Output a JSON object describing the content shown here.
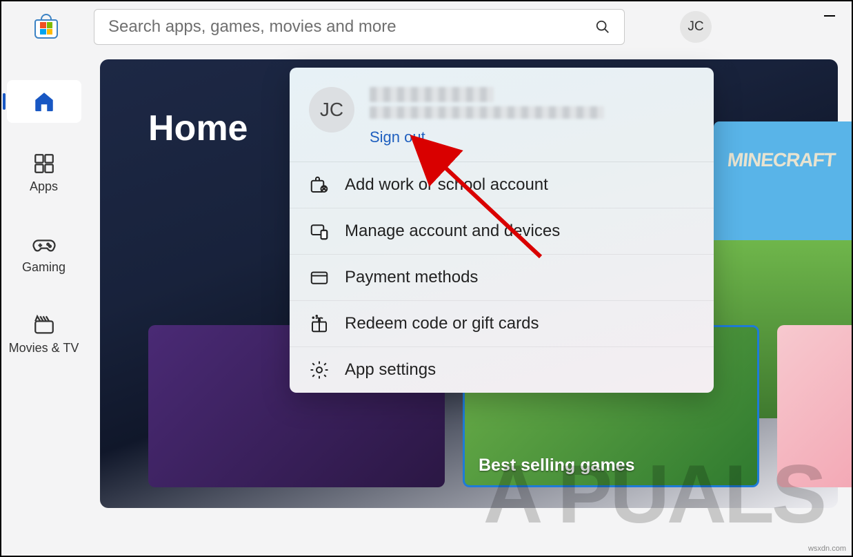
{
  "search": {
    "placeholder": "Search apps, games, movies and more"
  },
  "user": {
    "initials": "JC"
  },
  "sidebar": {
    "items": [
      {
        "label": "Home"
      },
      {
        "label": "Apps"
      },
      {
        "label": "Gaming"
      },
      {
        "label": "Movies & TV"
      }
    ]
  },
  "hero": {
    "title": "Home",
    "minecraft": "MINECRAFT",
    "tile_bestselling": "Best selling games"
  },
  "popup": {
    "initials": "JC",
    "sign_out": "Sign out",
    "items": [
      {
        "label": "Add work or school account"
      },
      {
        "label": "Manage account and devices"
      },
      {
        "label": "Payment methods"
      },
      {
        "label": "Redeem code or gift cards"
      },
      {
        "label": "App settings"
      }
    ]
  },
  "watermark": "A PUALS",
  "attrib": "wsxdn.com"
}
